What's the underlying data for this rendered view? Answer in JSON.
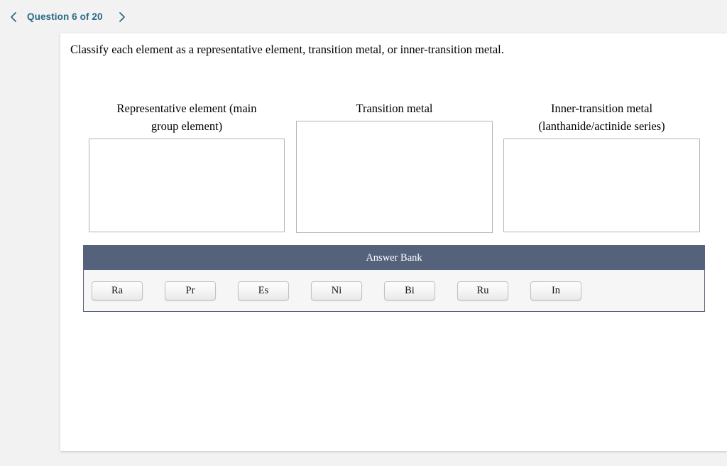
{
  "header": {
    "prev_icon": "chevron-left-icon",
    "next_icon": "chevron-right-icon",
    "question_counter": "Question 6 of 20",
    "accent_color": "#2a6a87"
  },
  "question": {
    "prompt": "Classify each element as a representative element, transition metal, or inner-transition metal."
  },
  "categories": [
    {
      "id": "representative",
      "header_line1": "Representative element (main",
      "header_line2": "group element)",
      "items": []
    },
    {
      "id": "transition",
      "header_line1": "Transition metal",
      "header_line2": "",
      "items": []
    },
    {
      "id": "inner-transition",
      "header_line1": "Inner-transition metal",
      "header_line2": "(lanthanide/actinide series)",
      "items": []
    }
  ],
  "answer_bank": {
    "title": "Answer Bank",
    "header_color": "#55627c",
    "body_color": "#f6f6f6",
    "tiles": [
      {
        "label": "Ra"
      },
      {
        "label": "Pr"
      },
      {
        "label": "Es"
      },
      {
        "label": "Ni"
      },
      {
        "label": "Bi"
      },
      {
        "label": "Ru"
      },
      {
        "label": "In"
      }
    ]
  }
}
